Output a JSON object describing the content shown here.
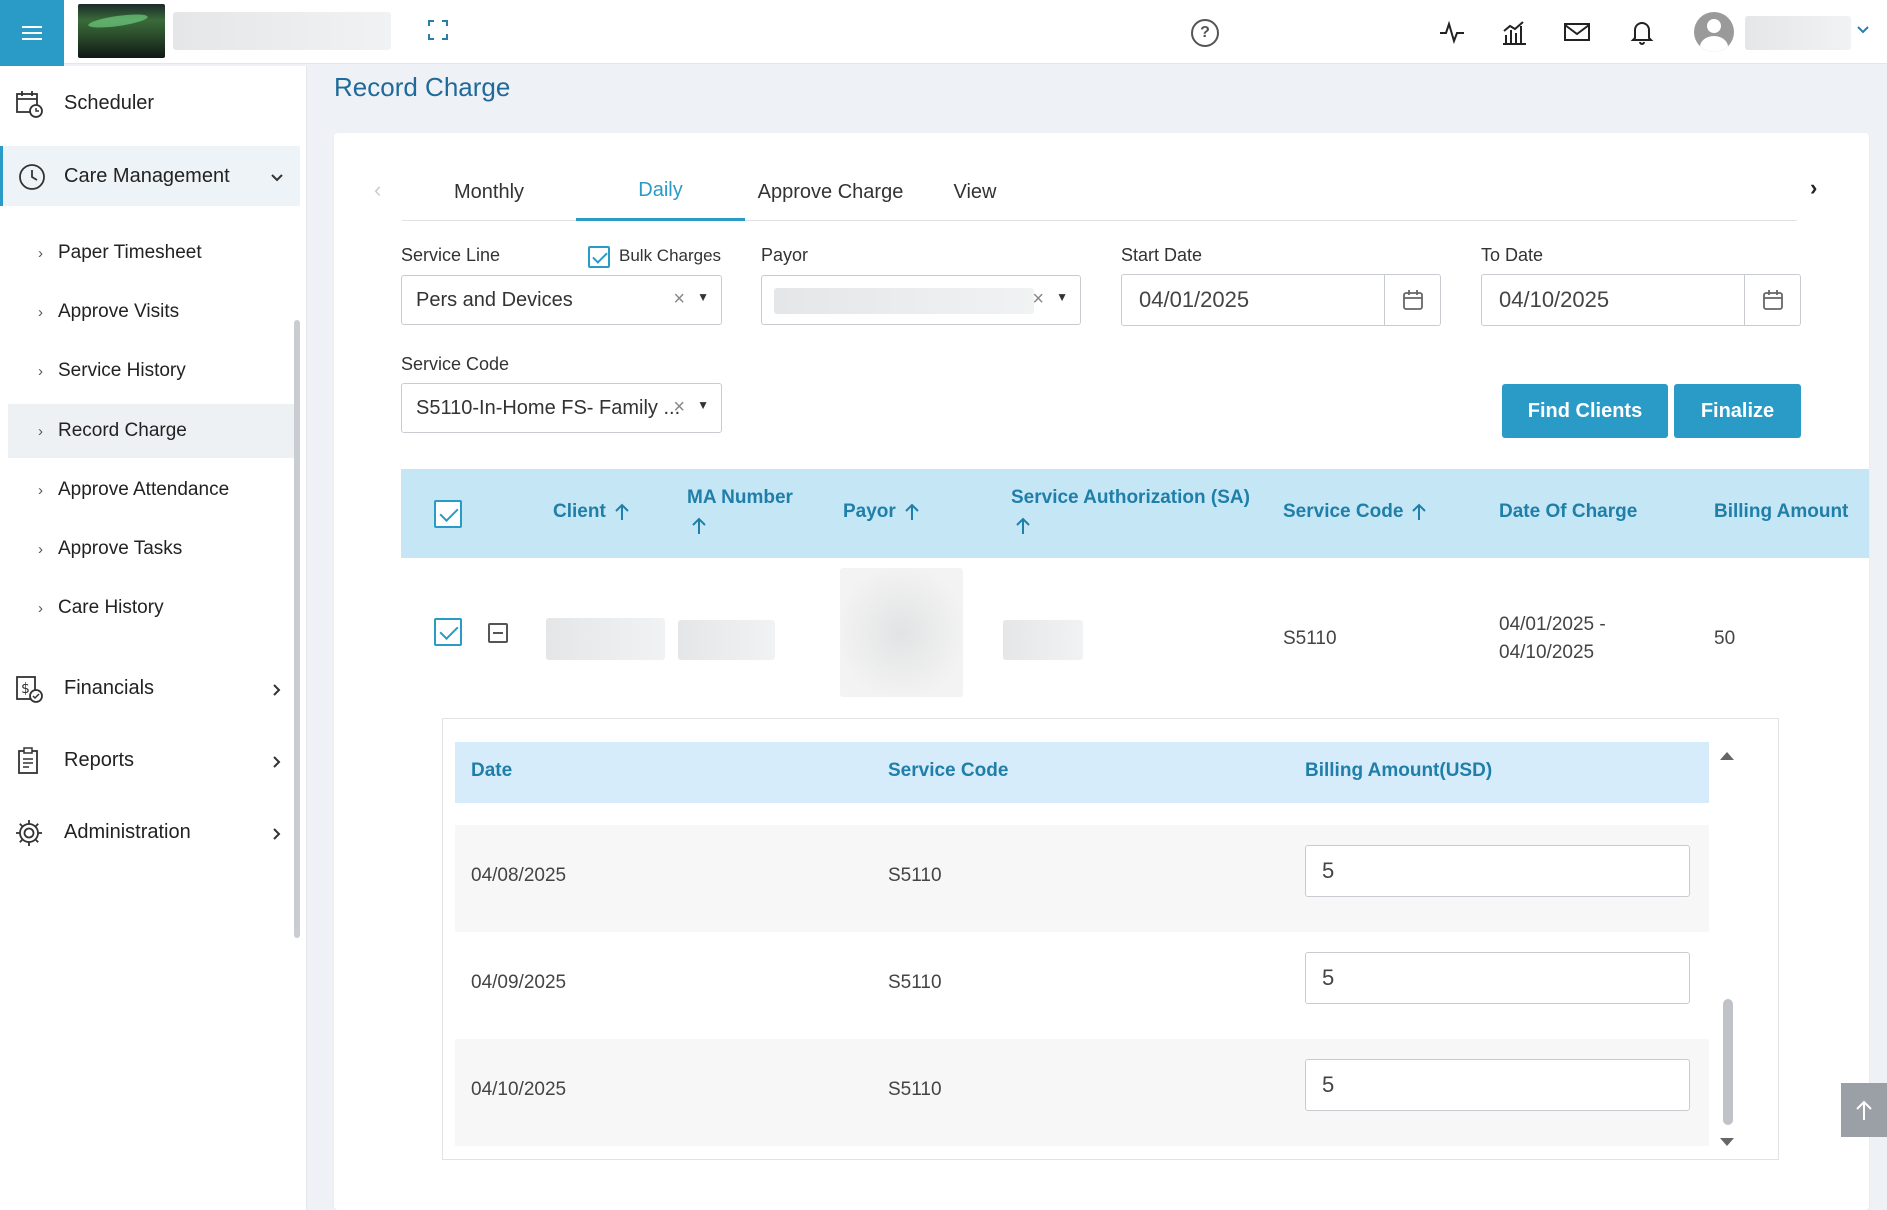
{
  "page": {
    "title": "Record Charge"
  },
  "sidebar": {
    "items": [
      {
        "label": "Scheduler",
        "icon": "calendar-clock-icon"
      },
      {
        "label": "Care Management",
        "icon": "clock-icon"
      },
      {
        "label": "Financials",
        "icon": "money-document-icon"
      },
      {
        "label": "Reports",
        "icon": "clipboard-icon"
      },
      {
        "label": "Administration",
        "icon": "gear-icon"
      }
    ],
    "subitems": [
      {
        "label": "Paper Timesheet"
      },
      {
        "label": "Approve Visits"
      },
      {
        "label": "Service History"
      },
      {
        "label": "Record Charge"
      },
      {
        "label": "Approve Attendance"
      },
      {
        "label": "Approve Tasks"
      },
      {
        "label": "Care History"
      }
    ],
    "subitem_arrow": "›"
  },
  "tabs": [
    {
      "label": "Monthly"
    },
    {
      "label": "Daily"
    },
    {
      "label": "Approve Charge"
    },
    {
      "label": "View"
    }
  ],
  "tab_nav": {
    "prev": "‹",
    "next": "›"
  },
  "filters": {
    "service_line": {
      "label": "Service Line",
      "value": "Pers and Devices"
    },
    "bulk_charges": {
      "label": "Bulk Charges",
      "checked": true
    },
    "payor": {
      "label": "Payor"
    },
    "start_date": {
      "label": "Start Date",
      "value": "04/01/2025"
    },
    "to_date": {
      "label": "To Date",
      "value": "04/10/2025"
    },
    "service_code": {
      "label": "Service Code",
      "value": "S5110-In-Home FS- Family ..."
    },
    "clear": "×",
    "caret": "▼"
  },
  "actions": {
    "find_clients": "Find Clients",
    "finalize": "Finalize"
  },
  "grid": {
    "columns": [
      {
        "label": "Client"
      },
      {
        "label": "MA Number"
      },
      {
        "label": "Payor"
      },
      {
        "label": "Service Authorization (SA)"
      },
      {
        "label": "Service Code"
      },
      {
        "label": "Date Of Charge"
      },
      {
        "label": "Billing Amount"
      }
    ],
    "row": {
      "service_code": "S5110",
      "date_of_charge_start": "04/01/2025 -",
      "date_of_charge_end": "04/10/2025",
      "billing_amount": "50"
    }
  },
  "subgrid": {
    "columns": [
      {
        "label": "Date"
      },
      {
        "label": "Service Code"
      },
      {
        "label": "Billing Amount(USD)"
      }
    ],
    "rows": [
      {
        "date": "04/08/2025",
        "service_code": "S5110",
        "amount": "5"
      },
      {
        "date": "04/09/2025",
        "service_code": "S5110",
        "amount": "5"
      },
      {
        "date": "04/10/2025",
        "service_code": "S5110",
        "amount": "5"
      }
    ]
  },
  "colors": {
    "accent": "#2a9bc7",
    "title": "#1f6a9a",
    "header_bg": "#c5e6f5",
    "subheader_bg": "#d6ecfa"
  }
}
